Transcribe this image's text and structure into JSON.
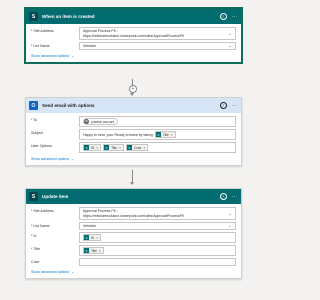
{
  "trigger": {
    "title": "When an item is created",
    "site_address_label": "* Site Address",
    "site_address_line1": "Approval Process PK -",
    "site_address_line2": "https://reitsharesolution.sharepoint.com/sites/ApprovalProcessPK",
    "list_name_label": "* List Name",
    "list_name_value": "Vehicles",
    "advanced": "Show advanced options"
  },
  "send_email": {
    "title": "Send email with options",
    "to_label": "* To",
    "to_avatar": "PA",
    "to_value": "practice account",
    "subject_label": "Subject",
    "subject_text": "Happy to hear, your Ready to leave by taking",
    "subject_token": "Title",
    "user_options_label": "User Options",
    "user_option_tokens": [
      "ID",
      "Title",
      "Color"
    ],
    "advanced": "Show advanced options"
  },
  "update_item": {
    "title": "Update item",
    "site_address_label": "* Site Address",
    "site_address_line1": "Approval Process PK -",
    "site_address_line2": "https://reitsharesolution.sharepoint.com/sites/ApprovalProcessPK",
    "list_name_label": "* List Name",
    "list_name_value": "Vehicles",
    "id_label": "* Id",
    "id_token": "ID",
    "title_label": "* Title",
    "title_token": "Title",
    "color_label": "Color",
    "color_value": "",
    "advanced": "Show advanced options"
  },
  "icons": {
    "sharepoint": "S",
    "outlook": "O",
    "help": "?",
    "more": "···",
    "chevron": "⌄",
    "plus": "+",
    "token_close": "×"
  },
  "colors": {
    "sharepoint_header": "#036c70",
    "outlook_header": "#d6e6f7",
    "link": "#0078d4",
    "selected_border": "#0f6e5a"
  }
}
